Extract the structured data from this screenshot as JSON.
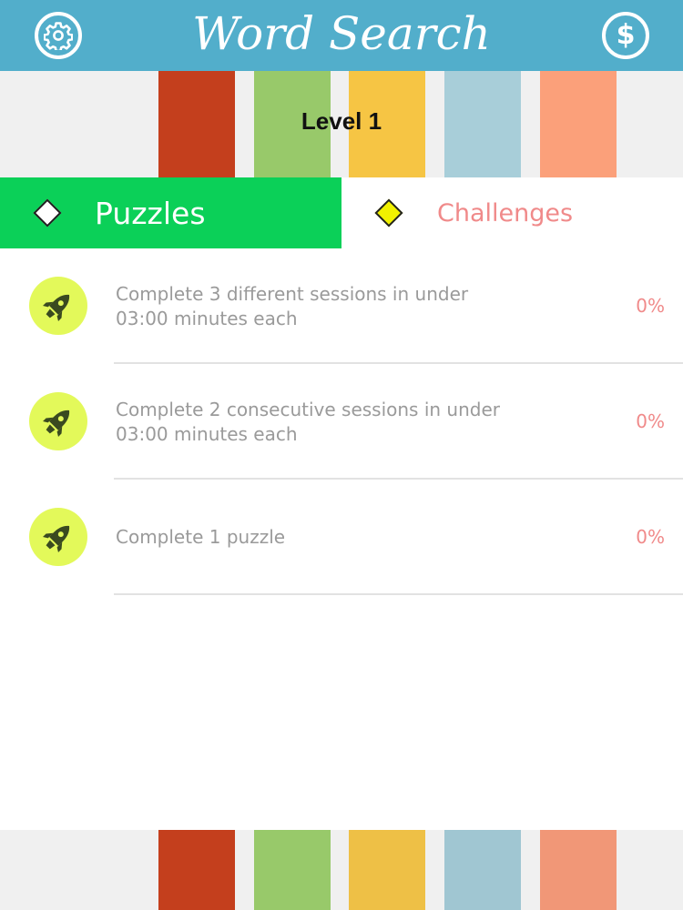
{
  "header": {
    "title": "Word Search",
    "settings_icon": "gear-icon",
    "coins_icon": "dollar-coin-icon",
    "coin_glyph": "$",
    "color": "#52aecb"
  },
  "level": {
    "label": "Level 1"
  },
  "stripes": {
    "top": [
      "#c43f1d",
      "#98c96a",
      "#f6c544",
      "#a8ced9",
      "#fba07a"
    ],
    "bottom": [
      "#c43f1d",
      "#98c96a",
      "#eec046",
      "#a0c6d2",
      "#f19777"
    ]
  },
  "tabs": [
    {
      "label": "Puzzles",
      "active": true,
      "color": "#0bd058"
    },
    {
      "label": "Challenges",
      "active": false,
      "color": "#f08a8a"
    }
  ],
  "challenges": [
    {
      "icon": "rocket-icon",
      "text": "Complete 3 different sessions in under 03:00 minutes each",
      "progress": "0%"
    },
    {
      "icon": "rocket-icon",
      "text": "Complete 2 consecutive sessions in under 03:00 minutes each",
      "progress": "0%"
    },
    {
      "icon": "rocket-icon",
      "text": "Complete 1 puzzle",
      "progress": "0%"
    }
  ]
}
